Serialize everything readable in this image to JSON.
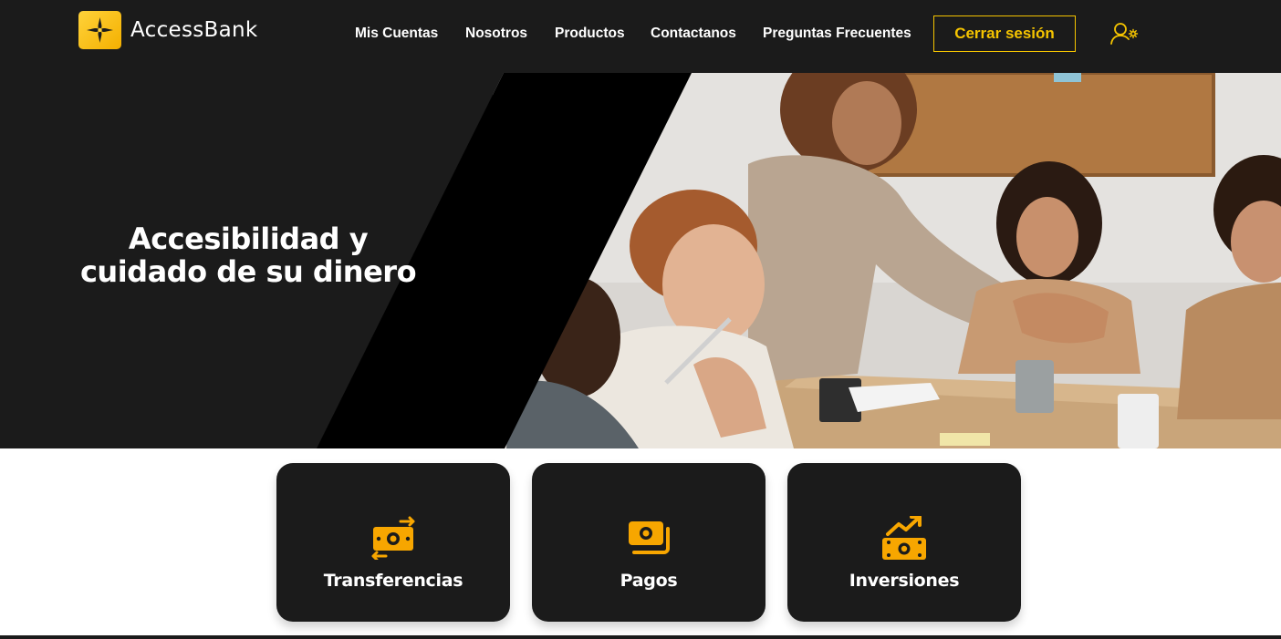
{
  "brand": {
    "name": "AccessBank",
    "accent_color": "#f5c400",
    "dark_color": "#1b1b1b",
    "icon_color": "#f7a600"
  },
  "nav": {
    "items": [
      {
        "label": "Mis Cuentas"
      },
      {
        "label": "Nosotros"
      },
      {
        "label": "Productos"
      },
      {
        "label": "Contactanos"
      },
      {
        "label": "Preguntas Frecuentes"
      }
    ],
    "logout_label": "Cerrar sesión",
    "user_icon": "user-settings-icon"
  },
  "hero": {
    "title": "Accesibilidad y cuidado de su dinero",
    "image_subject": "team-meeting-handshake-photo"
  },
  "services": [
    {
      "label": "Transferencias",
      "icon": "money-transfer-icon"
    },
    {
      "label": "Pagos",
      "icon": "payment-cash-icon"
    },
    {
      "label": "Inversiones",
      "icon": "investment-growth-icon"
    }
  ]
}
